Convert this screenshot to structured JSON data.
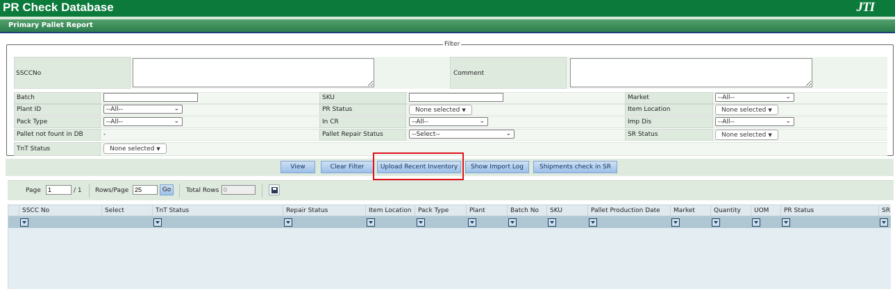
{
  "app": {
    "title": "PR Check Database",
    "logo": "JTI"
  },
  "page": {
    "title": "Primary Pallet Report"
  },
  "filter": {
    "legend": "Filter",
    "ssccno_label": "SSCCNo",
    "comment_label": "Comment",
    "rows": [
      [
        {
          "label": "Batch",
          "type": "text",
          "value": ""
        },
        {
          "label": "SKU",
          "type": "text",
          "value": ""
        },
        {
          "label": "Market",
          "type": "select",
          "value": "--All--"
        }
      ],
      [
        {
          "label": "Plant ID",
          "type": "select",
          "value": "--All--"
        },
        {
          "label": "PR Status",
          "type": "multiselect",
          "value": "None selected"
        },
        {
          "label": "Item Location",
          "type": "multiselect",
          "value": "None selected"
        }
      ],
      [
        {
          "label": "Pack Type",
          "type": "select",
          "value": "--All--"
        },
        {
          "label": "In CR",
          "type": "select",
          "value": "--All--"
        },
        {
          "label": "Imp Dis",
          "type": "select",
          "value": "--All--"
        }
      ],
      [
        {
          "label": "Pallet not fount in DB",
          "type": "static",
          "value": "-"
        },
        {
          "label": "Pallet Repair Status",
          "type": "select",
          "value": "--Select--"
        },
        {
          "label": "SR Status",
          "type": "multiselect",
          "value": "None selected"
        }
      ],
      [
        {
          "label": "TnT Status",
          "type": "multiselect",
          "value": "None selected"
        }
      ]
    ]
  },
  "buttons": {
    "view": "View",
    "clear_filter": "Clear Filter",
    "upload_inventory": "Upload Recent Inventory",
    "import_log": "Show Import Log",
    "shipments": "Shipments check in SR"
  },
  "pager": {
    "page_label": "Page",
    "page_value": "1",
    "of_total": "/ 1",
    "rows_label": "Rows/Page",
    "rows_value": "25",
    "go_label": "Go",
    "total_label": "Total Rows",
    "total_value": "0"
  },
  "grid": {
    "columns": [
      "SSCC No",
      "Select",
      "TnT Status",
      "Repair Status",
      "Item Location",
      "Pack Type",
      "Plant",
      "Batch No",
      "SKU",
      "Pallet Production Date",
      "Market",
      "Quantity",
      "UOM",
      "PR Status",
      "SR"
    ]
  },
  "colors": {
    "header_green": "#0b7a3b",
    "highlight": "#e0101a",
    "button_blue": "#9cc0e8"
  },
  "icons": [
    "save-icon",
    "dropdown-chevron-icon",
    "column-filter-icon",
    "textarea-resize-icon"
  ]
}
